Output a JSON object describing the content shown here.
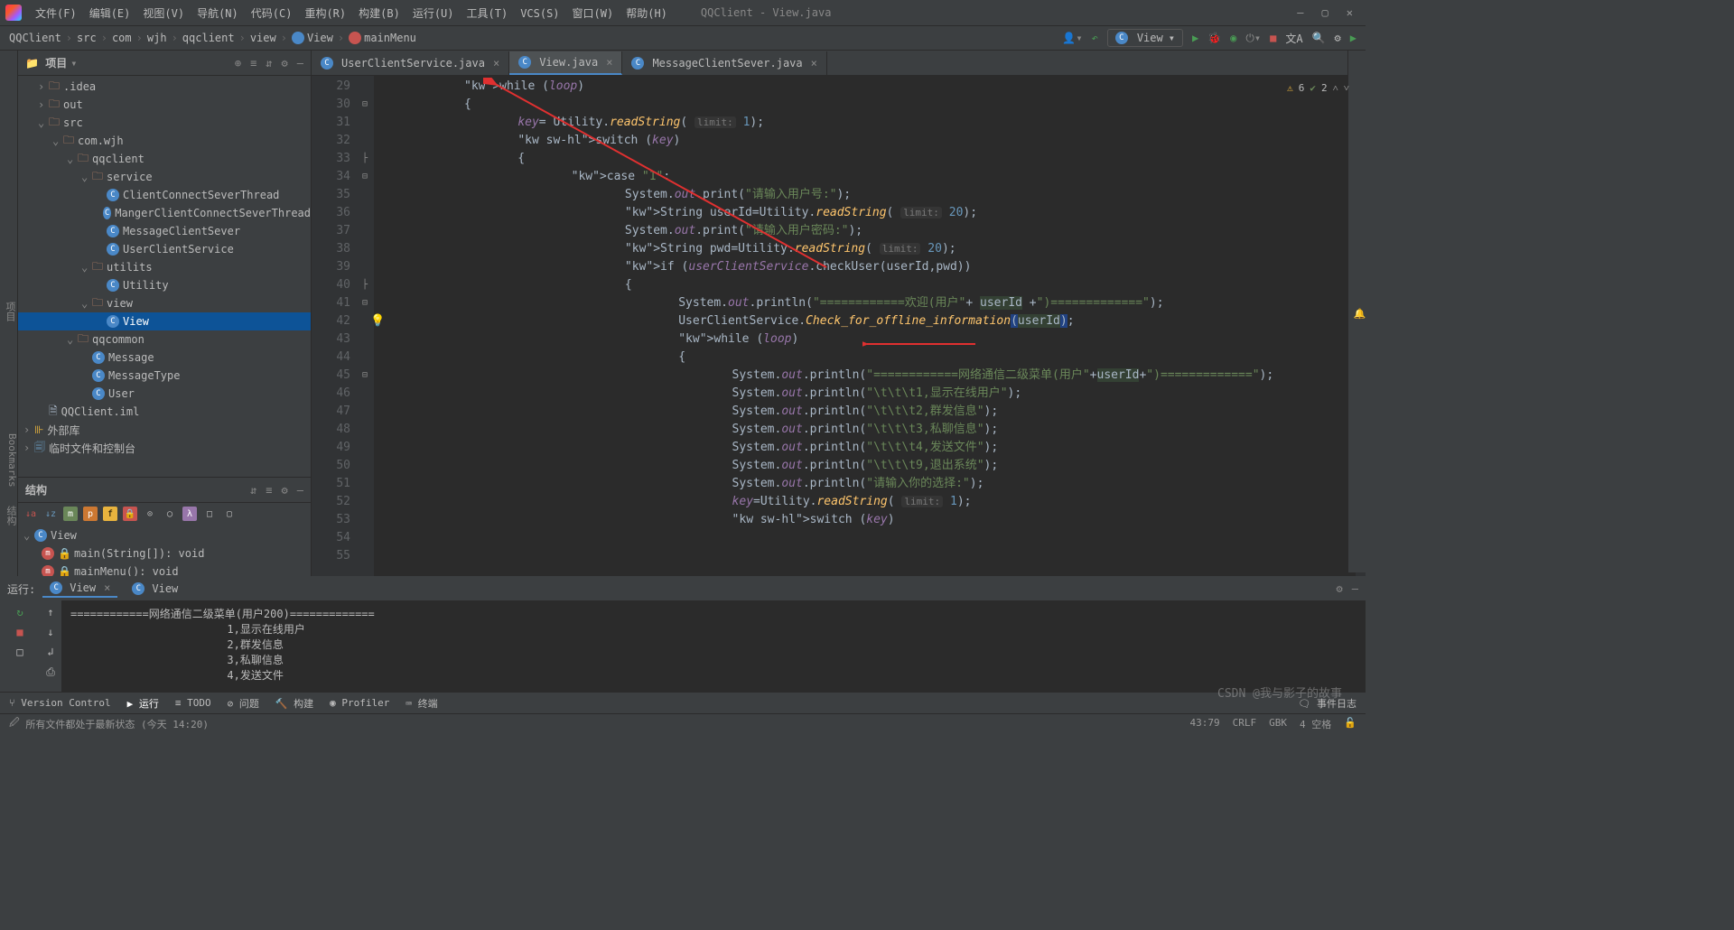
{
  "window": {
    "title": "QQClient - View.java"
  },
  "menu": [
    "文件(F)",
    "编辑(E)",
    "视图(V)",
    "导航(N)",
    "代码(C)",
    "重构(R)",
    "构建(B)",
    "运行(U)",
    "工具(T)",
    "VCS(S)",
    "窗口(W)",
    "帮助(H)"
  ],
  "breadcrumbs": {
    "items": [
      "QQClient",
      "src",
      "com",
      "wjh",
      "qqclient",
      "view",
      "View",
      "mainMenu"
    ]
  },
  "runConfig": "View",
  "projectPanel": {
    "title": "项目",
    "tree": [
      {
        "indent": 1,
        "tw": "›",
        "icon": "dir",
        "label": ".idea"
      },
      {
        "indent": 1,
        "tw": "›",
        "icon": "dir",
        "label": "out"
      },
      {
        "indent": 1,
        "tw": "⌄",
        "icon": "dir",
        "label": "src"
      },
      {
        "indent": 2,
        "tw": "⌄",
        "icon": "dir",
        "label": "com.wjh"
      },
      {
        "indent": 3,
        "tw": "⌄",
        "icon": "dir",
        "label": "qqclient"
      },
      {
        "indent": 4,
        "tw": "⌄",
        "icon": "dir",
        "label": "service"
      },
      {
        "indent": 5,
        "tw": "",
        "icon": "cls",
        "label": "ClientConnectSeverThread"
      },
      {
        "indent": 5,
        "tw": "",
        "icon": "cls",
        "label": "MangerClientConnectSeverThread"
      },
      {
        "indent": 5,
        "tw": "",
        "icon": "cls",
        "label": "MessageClientSever"
      },
      {
        "indent": 5,
        "tw": "",
        "icon": "cls",
        "label": "UserClientService"
      },
      {
        "indent": 4,
        "tw": "⌄",
        "icon": "dir",
        "label": "utilits"
      },
      {
        "indent": 5,
        "tw": "",
        "icon": "cls",
        "label": "Utility"
      },
      {
        "indent": 4,
        "tw": "⌄",
        "icon": "dir",
        "label": "view"
      },
      {
        "indent": 5,
        "tw": "",
        "icon": "cls",
        "label": "View",
        "sel": true
      },
      {
        "indent": 3,
        "tw": "⌄",
        "icon": "dir",
        "label": "qqcommon"
      },
      {
        "indent": 4,
        "tw": "",
        "icon": "cls",
        "label": "Message"
      },
      {
        "indent": 4,
        "tw": "",
        "icon": "cls",
        "label": "MessageType"
      },
      {
        "indent": 4,
        "tw": "",
        "icon": "cls",
        "label": "User"
      },
      {
        "indent": 1,
        "tw": "",
        "icon": "file",
        "label": "QQClient.iml"
      },
      {
        "indent": 0,
        "tw": "›",
        "icon": "lib",
        "label": "外部库"
      },
      {
        "indent": 0,
        "tw": "›",
        "icon": "scratch",
        "label": "临时文件和控制台"
      }
    ]
  },
  "structure": {
    "title": "结构",
    "root": "View",
    "items": [
      "main(String[]): void",
      "mainMenu(): void"
    ]
  },
  "tabs": [
    {
      "label": "UserClientService.java",
      "active": false
    },
    {
      "label": "View.java",
      "active": true
    },
    {
      "label": "MessageClientSever.java",
      "active": false
    }
  ],
  "inspection": {
    "warnings": "6",
    "oks": "2"
  },
  "code": {
    "startLine": 29,
    "lines": [
      "while (loop)",
      "{",
      "",
      "    key= Utility.readString( limit: 1);",
      "    switch (key)",
      "    {",
      "        case \"1\":",
      "            System.out.print(\"请输入用户号:\");",
      "            String userId=Utility.readString( limit: 20);",
      "            System.out.print(\"请输入用户密码:\");",
      "            String pwd=Utility.readString( limit: 20);",
      "            if (userClientService.checkUser(userId,pwd))",
      "            {",
      "                System.out.println(\"============欢迎(用户\"+ userId +\")=============\");",
      "                UserClientService.Check_for_offline_information(userId);",
      "                while (loop)",
      "                {",
      "                    System.out.println(\"============网络通信二级菜单(用户\"+userId+\")=============\");",
      "                    System.out.println(\"\\t\\t\\t1,显示在线用户\");",
      "                    System.out.println(\"\\t\\t\\t2,群发信息\");",
      "                    System.out.println(\"\\t\\t\\t3,私聊信息\");",
      "                    System.out.println(\"\\t\\t\\t4,发送文件\");",
      "                    System.out.println(\"\\t\\t\\t9,退出系统\");",
      "                    System.out.println(\"请输入你的选择:\");",
      "                    key=Utility.readString( limit: 1);",
      "",
      "                    switch (key)"
    ]
  },
  "run": {
    "title": "运行:",
    "tabs": [
      "View",
      "View"
    ],
    "console": "============网络通信二级菜单(用户200)=============\n\t\t\t1,显示在线用户\n\t\t\t2,群发信息\n\t\t\t3,私聊信息\n\t\t\t4,发送文件"
  },
  "bottomTools": [
    "Version Control",
    "运行",
    "TODO",
    "问题",
    "构建",
    "Profiler",
    "终端"
  ],
  "eventLog": "事件日志",
  "status": {
    "left": "所有文件都处于最新状态 (今天 14:20)",
    "pos": "43:79",
    "eol": "CRLF",
    "enc": "GBK",
    "indent": "4 空格"
  },
  "watermark": "CSDN @我与影子的故事",
  "leftToolTabs": [
    "项目",
    "Bookmarks",
    "结构"
  ]
}
